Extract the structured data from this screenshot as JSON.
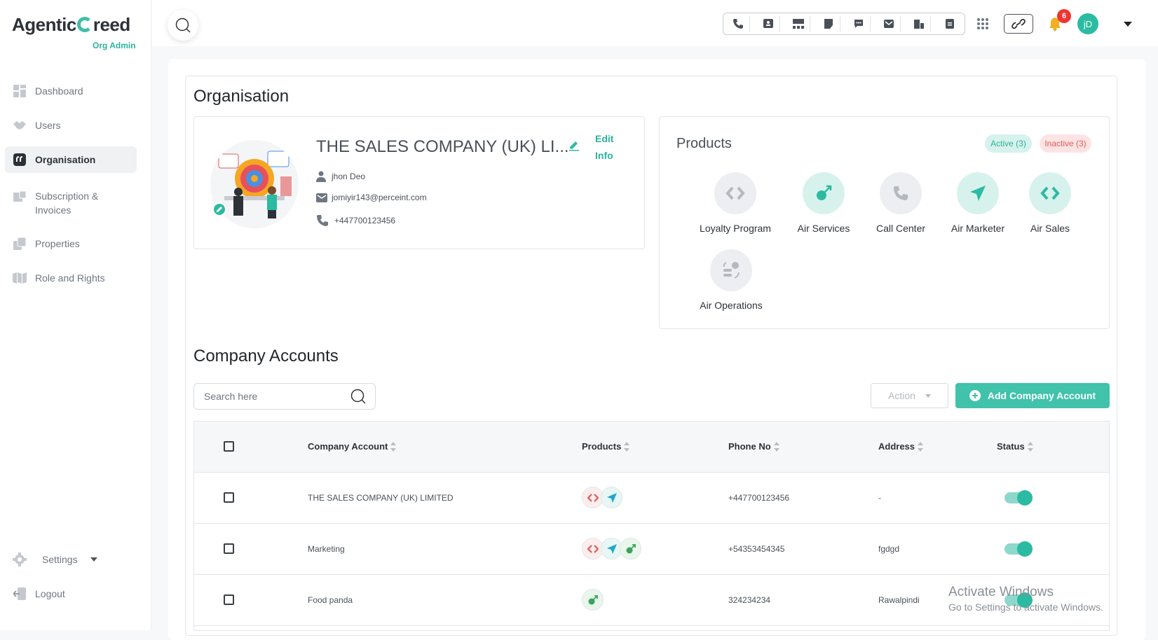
{
  "app": {
    "logo_text_a": "Agentic",
    "logo_text_b": "reed",
    "role": "Org Admin"
  },
  "sidebar": {
    "items": [
      {
        "label": "Dashboard"
      },
      {
        "label": "Users"
      },
      {
        "label": "Organisation"
      },
      {
        "label": "Subscription & Invoices"
      },
      {
        "label": "Properties"
      },
      {
        "label": "Role and Rights"
      }
    ],
    "settings": "Settings",
    "logout": "Logout"
  },
  "topbar": {
    "notification_count": "6",
    "avatar_initials": "jD"
  },
  "page": {
    "title": "Organisation"
  },
  "org": {
    "name": "THE SALES COMPANY (UK) LI...",
    "edit_label": "Edit Info",
    "contact_name": "jhon Deo",
    "email": "jomiyir143@perceint.com",
    "phone": "+447700123456"
  },
  "products": {
    "title": "Products",
    "active_label": "Active (3)",
    "inactive_label": "Inactive (3)",
    "items": [
      {
        "label": "Loyalty Program",
        "active": false
      },
      {
        "label": "Air Services",
        "active": true
      },
      {
        "label": "Call Center",
        "active": false
      },
      {
        "label": "Air Marketer",
        "active": true
      },
      {
        "label": "Air Sales",
        "active": true
      },
      {
        "label": "Air Operations",
        "active": false
      }
    ]
  },
  "accounts": {
    "title": "Company Accounts",
    "search_placeholder": "Search here",
    "action_label": "Action",
    "add_label": "Add Company Account",
    "columns": [
      "Company Account",
      "Products",
      "Phone No",
      "Address",
      "Status"
    ],
    "rows": [
      {
        "name": "THE SALES COMPANY (UK) LIMITED",
        "products": [
          "red",
          "teal"
        ],
        "phone": "+447700123456",
        "address": "-",
        "status": true
      },
      {
        "name": "Marketing",
        "products": [
          "red",
          "teal",
          "green"
        ],
        "phone": "+54353454345",
        "address": "fgdgd",
        "status": true
      },
      {
        "name": "Food panda",
        "products": [
          "green"
        ],
        "phone": "324234234",
        "address": "Rawalpindi",
        "status": true
      }
    ]
  },
  "watermark": {
    "line1": "Activate Windows",
    "line2": "Go to Settings to activate Windows."
  },
  "colors": {
    "accent": "#2bbba2",
    "danger": "#ef3434"
  }
}
